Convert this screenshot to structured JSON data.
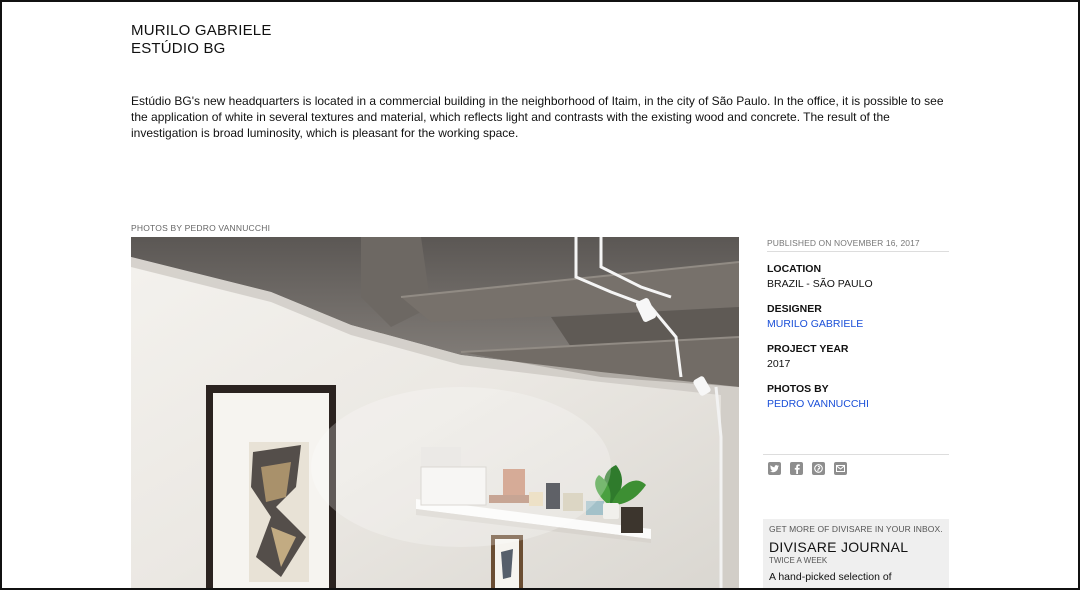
{
  "header": {
    "designer": "MURILO GABRIELE",
    "project": "ESTÚDIO BG"
  },
  "intro": "Estúdio BG's new headquarters is located in a commercial building in the neighborhood of Itaim, in the city of São Paulo. In the office, it is possible to see the application of white in several textures and material, which reflects light and contrasts with the existing wood and concrete. The result of the investigation is broad luminosity, which is pleasant for the working space.",
  "photo": {
    "credit": "PHOTOS BY PEDRO VANNUCCHI"
  },
  "sidebar": {
    "published": "PUBLISHED ON NOVEMBER 16, 2017",
    "location_label": "LOCATION",
    "location_value": "BRAZIL - SÃO PAULO",
    "designer_label": "DESIGNER",
    "designer_value": "MURILO GABRIELE",
    "year_label": "PROJECT YEAR",
    "year_value": "2017",
    "photos_label": "PHOTOS BY",
    "photos_value": "PEDRO VANNUCCHI"
  },
  "share": {
    "icons": [
      "twitter-icon",
      "facebook-icon",
      "pinterest-icon",
      "email-icon"
    ],
    "color": "#8e8e8e"
  },
  "newsletter": {
    "kicker": "GET MORE OF DIVISARE IN YOUR INBOX.",
    "title": "DIVISARE JOURNAL",
    "frequency": "TWICE A WEEK",
    "description": "A hand-picked selection of"
  },
  "colors": {
    "link": "#1a4fd8",
    "newsletter_bg": "#efefef"
  }
}
